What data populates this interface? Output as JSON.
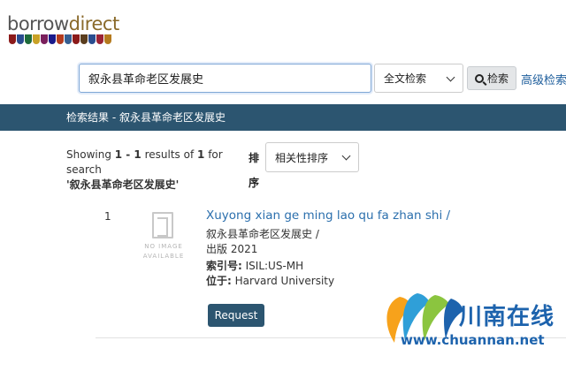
{
  "logo": {
    "text_1": "borrow",
    "text_2": "direct",
    "shield_colors": [
      "#8b1a1a",
      "#2a4d8f",
      "#1e6b3a",
      "#c9a227",
      "#7a1f5c",
      "#1a1a8b",
      "#b33b1e",
      "#365f91",
      "#8b1a1a",
      "#5a3d1e",
      "#2a4d8f",
      "#9b2335",
      "#b57a1e"
    ]
  },
  "search": {
    "query": "叙永县革命老区发展史",
    "type": "全文检索",
    "button_label": "检索",
    "advanced_label": "高级检索"
  },
  "results_bar": {
    "label": "检索结果 - 叙永县革命老区发展史"
  },
  "summary": {
    "prefix": "Showing ",
    "range": "1 - 1",
    "middle": " results of ",
    "total": "1",
    "suffix": " for search",
    "query": "'叙永县革命老区发展史'"
  },
  "sort": {
    "label": "排序",
    "value": "相关性排序"
  },
  "result": {
    "number": "1",
    "no_image_line1": "NO IMAGE",
    "no_image_line2": "AVAILABLE",
    "title": "Xuyong xian ge ming lao qu fa zhan shi /",
    "original_title": "叙永县革命老区发展史 /",
    "published": "出版 2021",
    "call_label": "索引号:",
    "call_value": " ISIL:US-MH",
    "location_label": "位于:",
    "location_value": " Harvard University",
    "request_label": "Request"
  },
  "watermark": {
    "cn": "川南在线",
    "en": "www.chuannan.net",
    "colors": [
      "#f7a21b",
      "#2f9fd8",
      "#8bc53f",
      "#1d63ad"
    ]
  }
}
